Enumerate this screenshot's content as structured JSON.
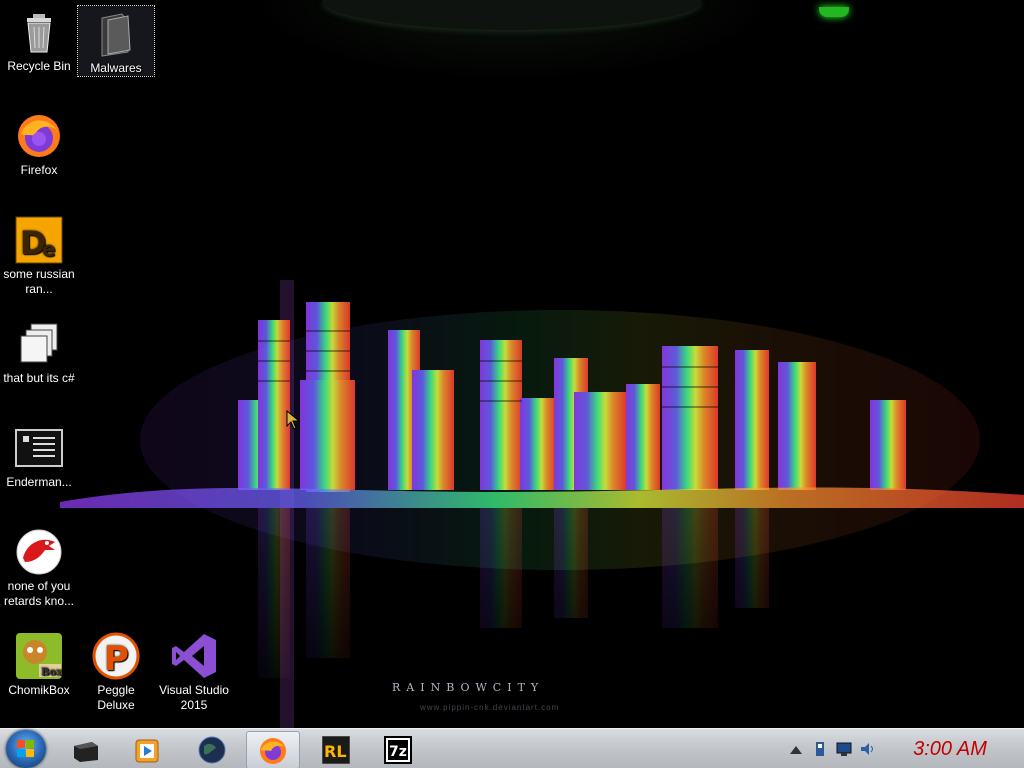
{
  "desktop": {
    "wallpaper": {
      "title": "RAINBOWCITY",
      "credit": "www.pippin-cnk.deviantart.com"
    },
    "icons": [
      {
        "label": "Recycle Bin",
        "icon": "recycle-bin-icon"
      },
      {
        "label": "Malwares",
        "icon": "folder-icon",
        "selected": true
      },
      {
        "label": "Firefox",
        "icon": "firefox-icon"
      },
      {
        "label": "some russian ran...",
        "icon": "de-app-icon"
      },
      {
        "label": "that but its c#",
        "icon": "windows-stack-icon"
      },
      {
        "label": "Enderman...",
        "icon": "console-icon"
      },
      {
        "label": "none of you retards kno...",
        "icon": "dino-icon"
      },
      {
        "label": "ChomikBox",
        "icon": "chomikbox-icon"
      },
      {
        "label": "Peggle Deluxe",
        "icon": "peggle-icon"
      },
      {
        "label": "Visual Studio 2015",
        "icon": "visual-studio-icon"
      }
    ]
  },
  "taskbar": {
    "start_label": "Start",
    "buttons": [
      {
        "name": "file-explorer",
        "icon": "explorer-icon"
      },
      {
        "name": "media-player",
        "icon": "media-player-icon"
      },
      {
        "name": "globe",
        "icon": "globe-icon"
      },
      {
        "name": "firefox",
        "icon": "firefox-icon",
        "active": true
      },
      {
        "name": "rl-app",
        "icon": "rl-icon"
      },
      {
        "name": "7zip",
        "icon": "sevenzip-icon"
      }
    ],
    "rl_text": "RL",
    "sevenzip_text": "7z",
    "tray_icons": [
      "arrow-up-icon",
      "usb-icon",
      "network-icon",
      "volume-icon"
    ],
    "clock": "3:00 AM"
  },
  "colors": {
    "clock": "#c30000",
    "taskbar": "#c3c7cc",
    "accent_green": "#22b822"
  }
}
